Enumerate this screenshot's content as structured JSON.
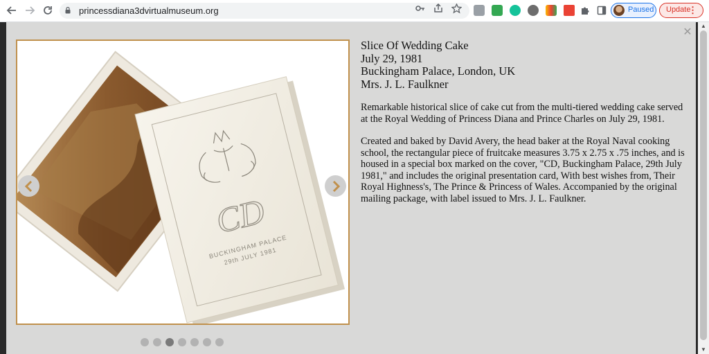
{
  "browser": {
    "url": "princessdiana3dvirtualmuseum.org",
    "profile_label": "Paused",
    "update_label": "Update"
  },
  "icons": {
    "back": "back-arrow-icon",
    "forward": "forward-arrow-icon",
    "reload": "reload-icon",
    "lock": "lock-icon",
    "key": "key-icon",
    "share": "share-icon",
    "bookmark": "star-icon",
    "close": "close-icon",
    "prev": "chevron-left-icon",
    "next": "chevron-right-icon"
  },
  "colors": {
    "accent_frame": "#c0904c",
    "arrow_chevron": "#c0904c",
    "lightbox_bg": "#d9d9d8",
    "paused_blue": "#1a73e8",
    "update_red": "#d93025"
  },
  "item": {
    "title": "Slice Of Wedding Cake",
    "date": "July 29, 1981",
    "location": "Buckingham Palace, London, UK",
    "owner": "Mrs. J. L. Faulkner",
    "description_1": "Remarkable historical slice of cake cut from the multi-tiered wedding cake served at the Royal Wedding of Princess Diana and Prince Charles on July 29, 1981.",
    "description_2": "Created and baked by David Avery, the head baker at the Royal Naval cooking school, the rectangular piece of fruitcake measures 3.75 x 2.75 x .75 inches, and is housed in a special box marked on the cover, \"CD, Buckingham Palace, 29th July 1981,\" and includes the original presentation card, With best wishes from, Their Royal Highness's, The Prince & Princess of Wales. Accompanied by the original mailing package, with label issued to Mrs. J. L. Faulkner."
  },
  "photo": {
    "monogram": "CD",
    "box_line_1": "BUCKINGHAM PALACE",
    "box_line_2": "29th JULY 1981"
  },
  "carousel": {
    "slide_count": 7,
    "active_index": 2
  }
}
